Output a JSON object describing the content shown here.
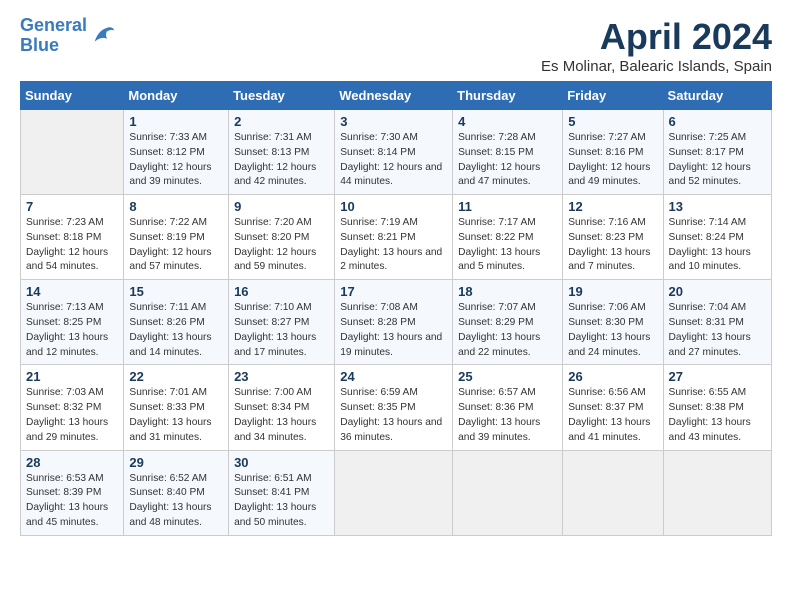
{
  "header": {
    "logo_line1": "General",
    "logo_line2": "Blue",
    "title": "April 2024",
    "subtitle": "Es Molinar, Balearic Islands, Spain"
  },
  "days_of_week": [
    "Sunday",
    "Monday",
    "Tuesday",
    "Wednesday",
    "Thursday",
    "Friday",
    "Saturday"
  ],
  "weeks": [
    [
      {
        "date": "",
        "sunrise": "",
        "sunset": "",
        "daylight": ""
      },
      {
        "date": "1",
        "sunrise": "Sunrise: 7:33 AM",
        "sunset": "Sunset: 8:12 PM",
        "daylight": "Daylight: 12 hours and 39 minutes."
      },
      {
        "date": "2",
        "sunrise": "Sunrise: 7:31 AM",
        "sunset": "Sunset: 8:13 PM",
        "daylight": "Daylight: 12 hours and 42 minutes."
      },
      {
        "date": "3",
        "sunrise": "Sunrise: 7:30 AM",
        "sunset": "Sunset: 8:14 PM",
        "daylight": "Daylight: 12 hours and 44 minutes."
      },
      {
        "date": "4",
        "sunrise": "Sunrise: 7:28 AM",
        "sunset": "Sunset: 8:15 PM",
        "daylight": "Daylight: 12 hours and 47 minutes."
      },
      {
        "date": "5",
        "sunrise": "Sunrise: 7:27 AM",
        "sunset": "Sunset: 8:16 PM",
        "daylight": "Daylight: 12 hours and 49 minutes."
      },
      {
        "date": "6",
        "sunrise": "Sunrise: 7:25 AM",
        "sunset": "Sunset: 8:17 PM",
        "daylight": "Daylight: 12 hours and 52 minutes."
      }
    ],
    [
      {
        "date": "7",
        "sunrise": "Sunrise: 7:23 AM",
        "sunset": "Sunset: 8:18 PM",
        "daylight": "Daylight: 12 hours and 54 minutes."
      },
      {
        "date": "8",
        "sunrise": "Sunrise: 7:22 AM",
        "sunset": "Sunset: 8:19 PM",
        "daylight": "Daylight: 12 hours and 57 minutes."
      },
      {
        "date": "9",
        "sunrise": "Sunrise: 7:20 AM",
        "sunset": "Sunset: 8:20 PM",
        "daylight": "Daylight: 12 hours and 59 minutes."
      },
      {
        "date": "10",
        "sunrise": "Sunrise: 7:19 AM",
        "sunset": "Sunset: 8:21 PM",
        "daylight": "Daylight: 13 hours and 2 minutes."
      },
      {
        "date": "11",
        "sunrise": "Sunrise: 7:17 AM",
        "sunset": "Sunset: 8:22 PM",
        "daylight": "Daylight: 13 hours and 5 minutes."
      },
      {
        "date": "12",
        "sunrise": "Sunrise: 7:16 AM",
        "sunset": "Sunset: 8:23 PM",
        "daylight": "Daylight: 13 hours and 7 minutes."
      },
      {
        "date": "13",
        "sunrise": "Sunrise: 7:14 AM",
        "sunset": "Sunset: 8:24 PM",
        "daylight": "Daylight: 13 hours and 10 minutes."
      }
    ],
    [
      {
        "date": "14",
        "sunrise": "Sunrise: 7:13 AM",
        "sunset": "Sunset: 8:25 PM",
        "daylight": "Daylight: 13 hours and 12 minutes."
      },
      {
        "date": "15",
        "sunrise": "Sunrise: 7:11 AM",
        "sunset": "Sunset: 8:26 PM",
        "daylight": "Daylight: 13 hours and 14 minutes."
      },
      {
        "date": "16",
        "sunrise": "Sunrise: 7:10 AM",
        "sunset": "Sunset: 8:27 PM",
        "daylight": "Daylight: 13 hours and 17 minutes."
      },
      {
        "date": "17",
        "sunrise": "Sunrise: 7:08 AM",
        "sunset": "Sunset: 8:28 PM",
        "daylight": "Daylight: 13 hours and 19 minutes."
      },
      {
        "date": "18",
        "sunrise": "Sunrise: 7:07 AM",
        "sunset": "Sunset: 8:29 PM",
        "daylight": "Daylight: 13 hours and 22 minutes."
      },
      {
        "date": "19",
        "sunrise": "Sunrise: 7:06 AM",
        "sunset": "Sunset: 8:30 PM",
        "daylight": "Daylight: 13 hours and 24 minutes."
      },
      {
        "date": "20",
        "sunrise": "Sunrise: 7:04 AM",
        "sunset": "Sunset: 8:31 PM",
        "daylight": "Daylight: 13 hours and 27 minutes."
      }
    ],
    [
      {
        "date": "21",
        "sunrise": "Sunrise: 7:03 AM",
        "sunset": "Sunset: 8:32 PM",
        "daylight": "Daylight: 13 hours and 29 minutes."
      },
      {
        "date": "22",
        "sunrise": "Sunrise: 7:01 AM",
        "sunset": "Sunset: 8:33 PM",
        "daylight": "Daylight: 13 hours and 31 minutes."
      },
      {
        "date": "23",
        "sunrise": "Sunrise: 7:00 AM",
        "sunset": "Sunset: 8:34 PM",
        "daylight": "Daylight: 13 hours and 34 minutes."
      },
      {
        "date": "24",
        "sunrise": "Sunrise: 6:59 AM",
        "sunset": "Sunset: 8:35 PM",
        "daylight": "Daylight: 13 hours and 36 minutes."
      },
      {
        "date": "25",
        "sunrise": "Sunrise: 6:57 AM",
        "sunset": "Sunset: 8:36 PM",
        "daylight": "Daylight: 13 hours and 39 minutes."
      },
      {
        "date": "26",
        "sunrise": "Sunrise: 6:56 AM",
        "sunset": "Sunset: 8:37 PM",
        "daylight": "Daylight: 13 hours and 41 minutes."
      },
      {
        "date": "27",
        "sunrise": "Sunrise: 6:55 AM",
        "sunset": "Sunset: 8:38 PM",
        "daylight": "Daylight: 13 hours and 43 minutes."
      }
    ],
    [
      {
        "date": "28",
        "sunrise": "Sunrise: 6:53 AM",
        "sunset": "Sunset: 8:39 PM",
        "daylight": "Daylight: 13 hours and 45 minutes."
      },
      {
        "date": "29",
        "sunrise": "Sunrise: 6:52 AM",
        "sunset": "Sunset: 8:40 PM",
        "daylight": "Daylight: 13 hours and 48 minutes."
      },
      {
        "date": "30",
        "sunrise": "Sunrise: 6:51 AM",
        "sunset": "Sunset: 8:41 PM",
        "daylight": "Daylight: 13 hours and 50 minutes."
      },
      {
        "date": "",
        "sunrise": "",
        "sunset": "",
        "daylight": ""
      },
      {
        "date": "",
        "sunrise": "",
        "sunset": "",
        "daylight": ""
      },
      {
        "date": "",
        "sunrise": "",
        "sunset": "",
        "daylight": ""
      },
      {
        "date": "",
        "sunrise": "",
        "sunset": "",
        "daylight": ""
      }
    ]
  ]
}
